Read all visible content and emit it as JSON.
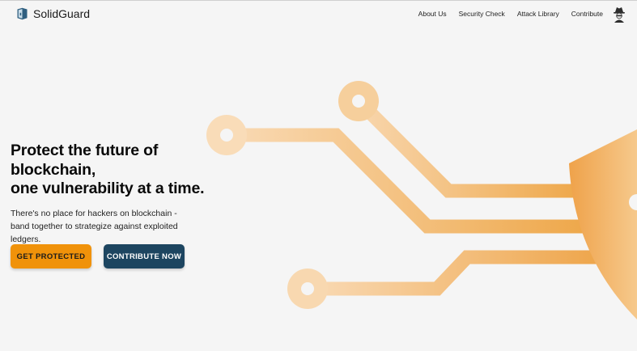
{
  "brand": {
    "name": "SolidGuard",
    "logo_icon": "shield-logo-icon"
  },
  "nav": {
    "items": [
      {
        "label": "About Us"
      },
      {
        "label": "Security Check"
      },
      {
        "label": "Attack Library"
      },
      {
        "label": "Contribute"
      }
    ],
    "avatar_icon": "hacker-avatar-icon"
  },
  "hero": {
    "title_lines": [
      "Protect the future of",
      "blockchain,",
      "one vulnerability at a time."
    ],
    "description": "There's no place for hackers on blockchain - band together to strategize against exploited ledgers.",
    "primary_button": "GET PROTECTED",
    "secondary_button": "CONTRIBUTE NOW"
  },
  "colors": {
    "accent_orange": "#f0920a",
    "button_dark": "#1d4560",
    "circuit_light": "#f8d2a2",
    "circuit_dark": "#eea54a",
    "background": "#f5f5f5"
  }
}
